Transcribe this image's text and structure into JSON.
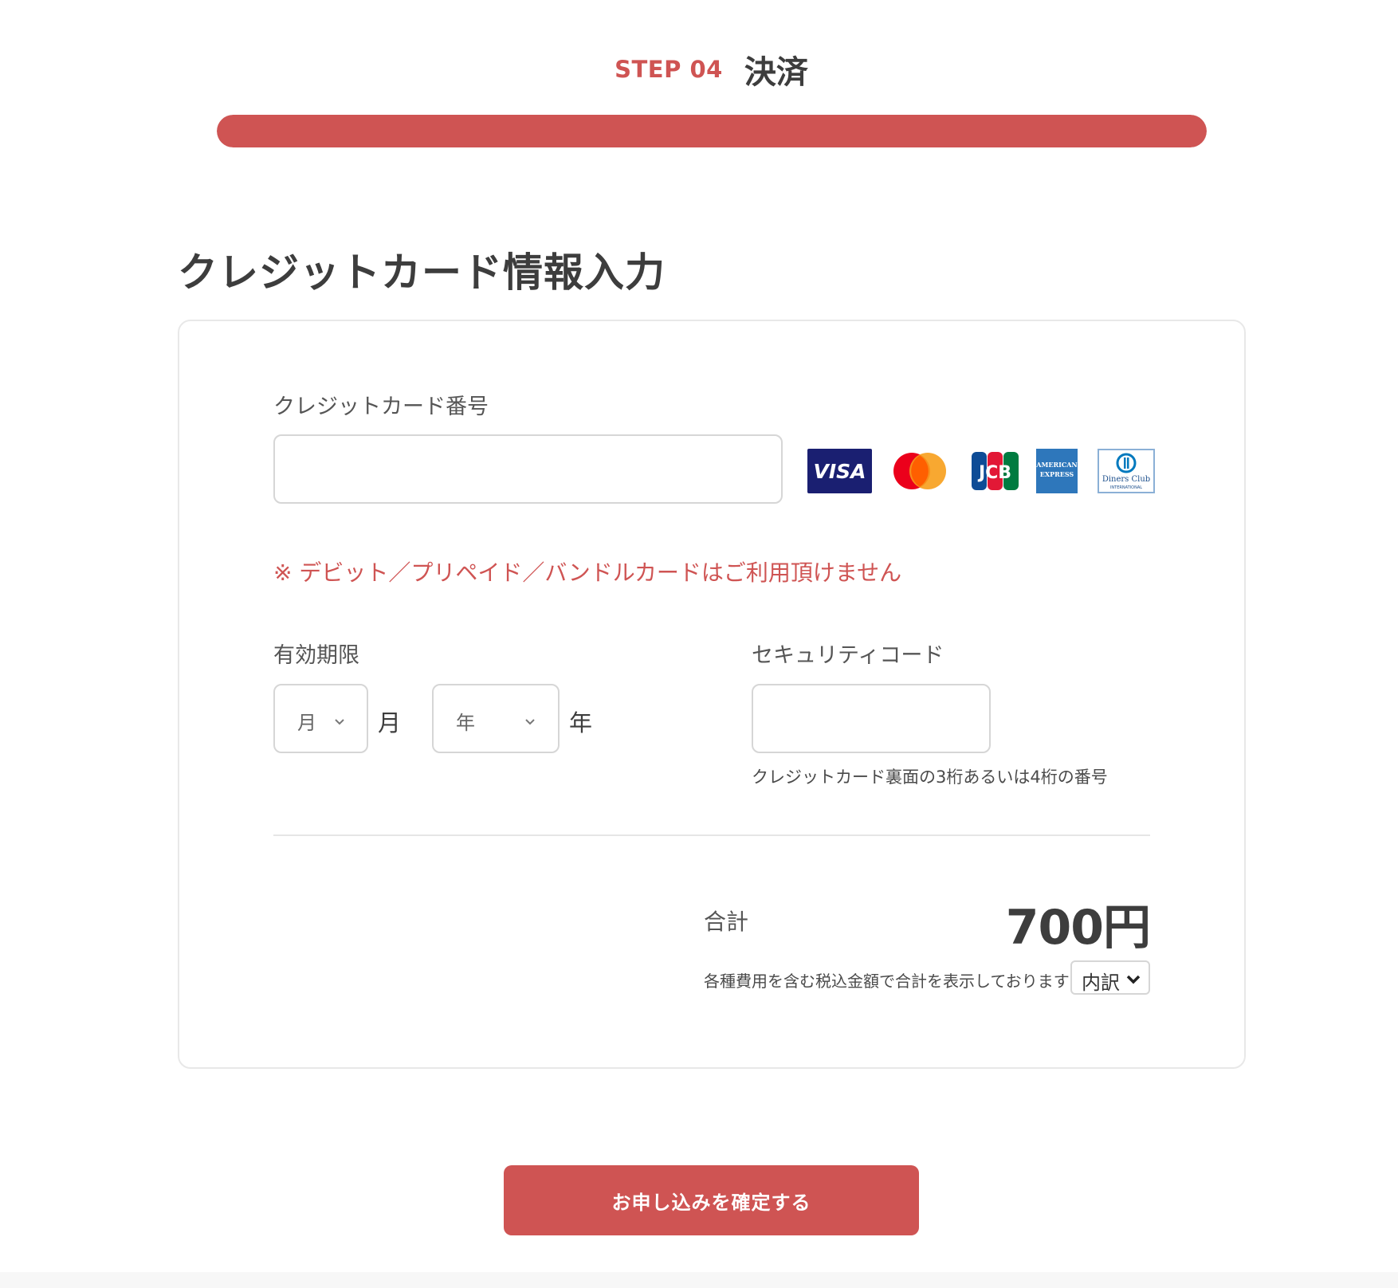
{
  "step": {
    "label": "STEP 04",
    "title": "決済"
  },
  "progress": {
    "fraction": 1.0,
    "color": "#cf5453"
  },
  "page_title": "クレジットカード情報入力",
  "card_number": {
    "label": "クレジットカード番号",
    "value": "",
    "placeholder": ""
  },
  "card_brands": {
    "visa": "VISA",
    "mastercard": "mastercard-icon",
    "jcb": "JCB",
    "amex_line1": "AMERICAN",
    "amex_line2": "EXPRESS",
    "diners_line1": "Diners Club",
    "diners_line2": "INTERNATIONAL"
  },
  "notice": "※ デビット／プリペイド／バンドルカードはご利用頂けません",
  "expiry": {
    "label": "有効期限",
    "month_placeholder": "月",
    "month_unit": "月",
    "year_placeholder": "年",
    "year_unit": "年"
  },
  "security_code": {
    "label": "セキュリティコード",
    "value": "",
    "help": "クレジットカード裏面の3桁あるいは4桁の番号"
  },
  "summary": {
    "total_label": "合計",
    "total_amount": "700円",
    "tax_note": "各種費用を含む税込金額で合計を表示しております",
    "breakdown_label": "内訳"
  },
  "submit_label": "お申し込みを確定する",
  "colors": {
    "accent": "#cf5453",
    "text_dark": "#3d3d3d",
    "border": "#d6d6d6"
  }
}
